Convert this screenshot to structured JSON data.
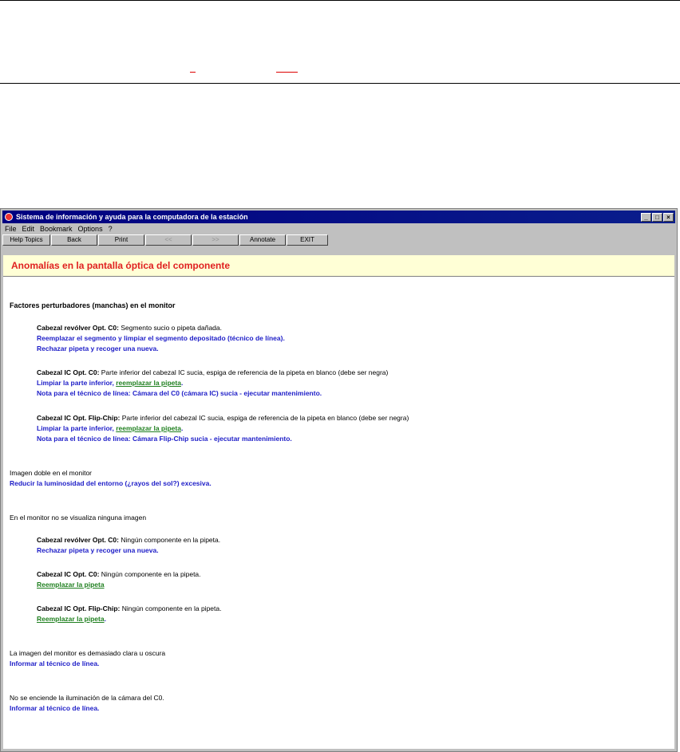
{
  "window": {
    "title": "Sistema de información y ayuda para la computadora de la estación",
    "controls": {
      "minimize": "_",
      "maximize": "□",
      "close": "×"
    }
  },
  "menu": [
    "File",
    "Edit",
    "Bookmark",
    "Options",
    "?"
  ],
  "toolbar": [
    {
      "label": "Help Topics",
      "enabled": true
    },
    {
      "label": "Back",
      "enabled": true
    },
    {
      "label": "Print",
      "enabled": true
    },
    {
      "label": "<<",
      "enabled": false
    },
    {
      "label": ">>",
      "enabled": false
    },
    {
      "label": "Annotate",
      "enabled": true
    },
    {
      "label": "EXIT",
      "enabled": true
    }
  ],
  "page_title": "Anomalías en la pantalla óptica del componente",
  "sections": {
    "s1_heading": "Factores perturbadores (manchas) en el monitor",
    "a_label": "Cabezal revólver Opt. C0:",
    "a_text": " Segmento sucio o pipeta dañada.",
    "a_action1": "Reemplazar el segmento y limpiar el segmento depositado (técnico de línea).",
    "a_action2": "Rechazar pipeta y recoger una nueva.",
    "b_label": "Cabezal IC Opt. C0:",
    "b_text": " Parte inferior del cabezal IC sucia, espiga de referencia de la pipeta en blanco (debe ser negra)",
    "b_action1_pre": "Limpiar la parte inferior, ",
    "b_action1_link": "reemplazar la pipeta",
    "b_action1_post": ".",
    "b_action2": "Nota para el técnico de línea: Cámara del C0 (cámara IC) sucia - ejecutar mantenimiento.",
    "c_label": "Cabezal IC Opt. Flip-Chip:",
    "c_text": " Parte inferior del cabezal IC sucia, espiga de referencia de la pipeta en blanco (debe ser negra)",
    "c_action1_pre": "Limpiar la parte inferior, ",
    "c_action1_link": "reemplazar la pipeta",
    "c_action1_post": ".",
    "c_action2": "Nota para el técnico de línea: Cámara Flip-Chip sucia - ejecutar mantenimiento.",
    "s2_heading": "Imagen doble en el monitor",
    "s2_action": "Reducir la luminosidad del entorno (¿rayos del sol?) excesiva.",
    "s3_heading": "En el monitor no se visualiza ninguna imagen",
    "d_label": "Cabezal revólver Opt. C0:",
    "d_text": " Ningún componente en la pipeta.",
    "d_action": "Rechazar pipeta y recoger una nueva.",
    "e_label": "Cabezal IC Opt. C0:",
    "e_text": " Ningún componente en la pipeta.",
    "e_link": "Reemplazar la pipeta",
    "f_label": "Cabezal IC Opt. Flip-Chip:",
    "f_text": " Ningún componente en la pipeta.",
    "f_link": "Reemplazar la pipeta",
    "f_post": ".",
    "s4_heading": "La imagen del monitor es demasiado clara u oscura",
    "s4_action": "Informar al técnico de línea.",
    "s5_heading": "No se enciende la iluminación de la cámara del C0.",
    "s5_action": "Informar al técnico de línea."
  }
}
